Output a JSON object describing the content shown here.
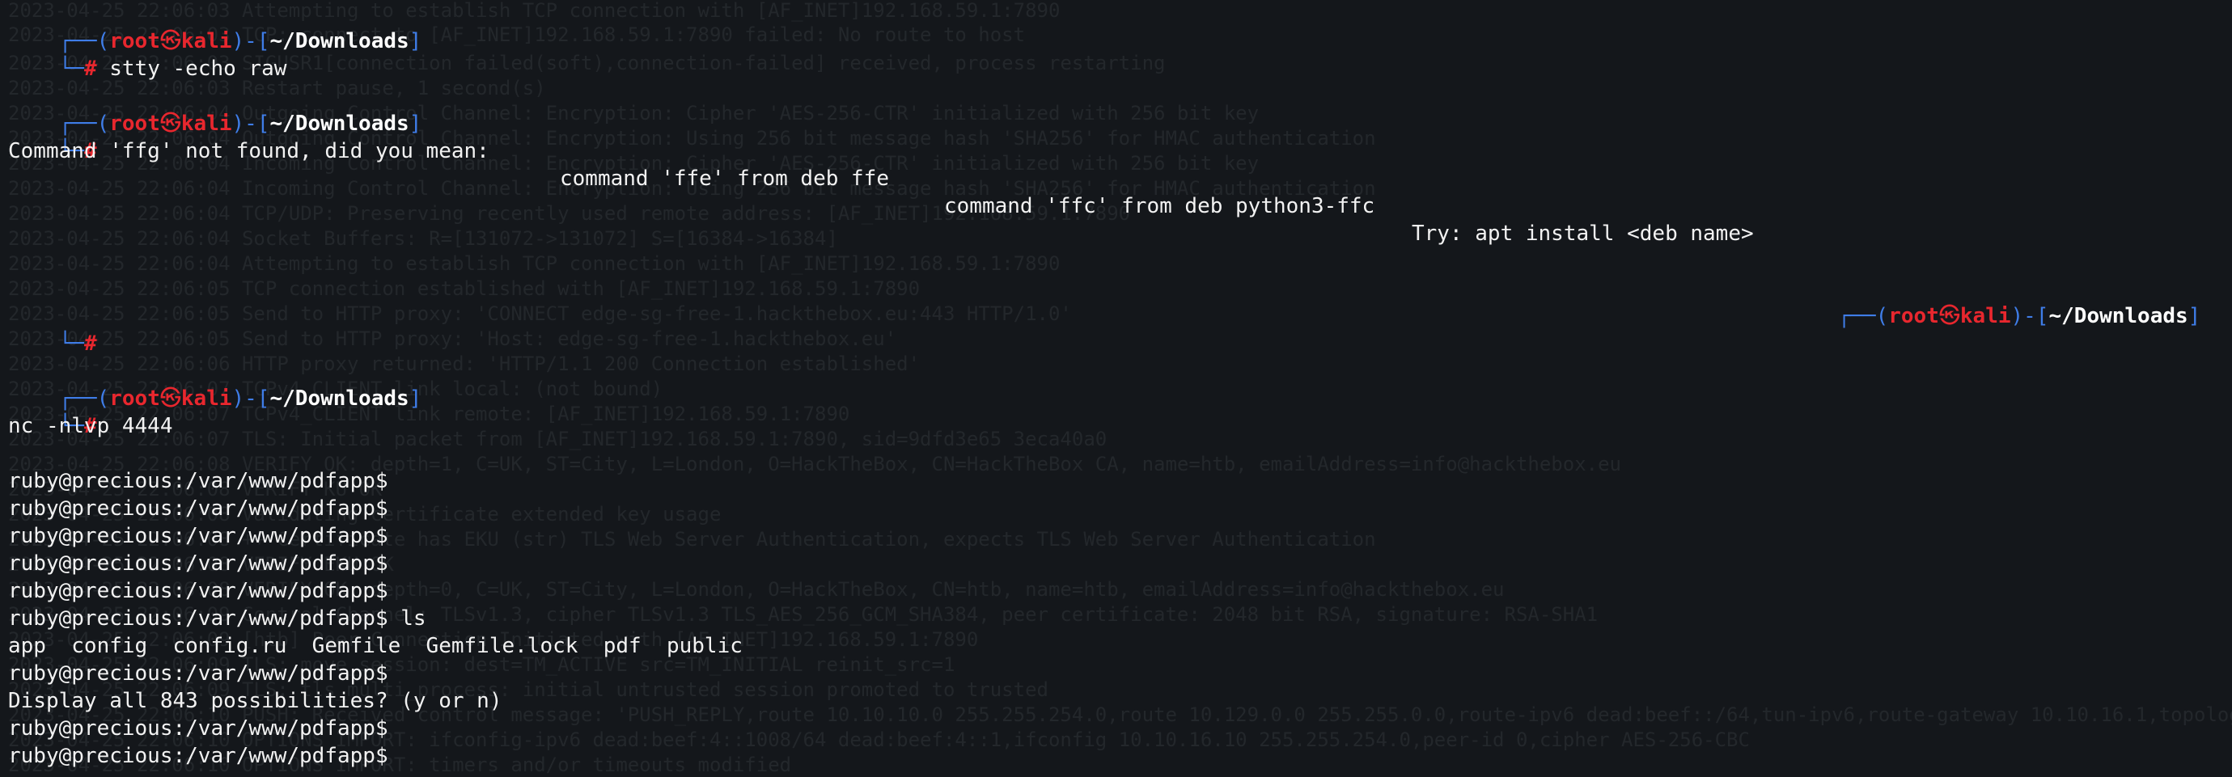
{
  "prompt": {
    "user": "root",
    "skull": "㉿",
    "host": "kali",
    "cwd": "~/Downloads",
    "open_corner": "┌──",
    "paren_open": "(",
    "paren_close": ")",
    "dash": "-",
    "bracket_open": "[",
    "bracket_close": "]",
    "close_corner": "└─",
    "hash": "#"
  },
  "colors": {
    "background": "#14171b",
    "prompt_frame": "#3f7de8",
    "prompt_user": "#e8272e",
    "text": "#f2f2f2"
  },
  "terminal": {
    "commands": {
      "stty": "stty -echo raw",
      "nc": "nc -nlvp 4444"
    },
    "ffg_not_found": "Command 'ffg' not found, did you mean:",
    "suggestion_ffe": "command 'ffe' from deb ffe",
    "suggestion_ffc": "command 'ffc' from deb python3-ffc",
    "try_install": "Try: apt install <deb name>",
    "ruby_prompt": "ruby@precious:/var/www/pdfapp$",
    "ruby_ls_cmd": " ls",
    "ls_output": "app  config  config.ru  Gemfile  Gemfile.lock  pdf  public",
    "display_all": "Display all 843 possibilities? (y or n)"
  },
  "background_log": [
    "2023-04-25 22:06:03 Attempting to establish TCP connection with [AF_INET]192.168.59.1:7890",
    "2023-04-25 22:06:03 TCP: connect to [AF_INET]192.168.59.1:7890 failed: No route to host",
    "2023-04-25 22:06:03 SIGUSR1[connection failed(soft),connection-failed] received, process restarting",
    "2023-04-25 22:06:03 Restart pause, 1 second(s)",
    "2023-04-25 22:06:04 Outgoing Control Channel: Encryption: Cipher 'AES-256-CTR' initialized with 256 bit key",
    "2023-04-25 22:06:04 Outgoing Control Channel: Encryption: Using 256 bit message hash 'SHA256' for HMAC authentication",
    "2023-04-25 22:06:04 Incoming Control Channel: Encryption: Cipher 'AES-256-CTR' initialized with 256 bit key",
    "2023-04-25 22:06:04 Incoming Control Channel: Encryption: Using 256 bit message hash 'SHA256' for HMAC authentication",
    "2023-04-25 22:06:04 TCP/UDP: Preserving recently used remote address: [AF_INET]192.168.59.1:7890",
    "2023-04-25 22:06:04 Socket Buffers: R=[131072->131072] S=[16384->16384]",
    "2023-04-25 22:06:04 Attempting to establish TCP connection with [AF_INET]192.168.59.1:7890",
    "2023-04-25 22:06:05 TCP connection established with [AF_INET]192.168.59.1:7890",
    "2023-04-25 22:06:05 Send to HTTP proxy: 'CONNECT edge-sg-free-1.hackthebox.eu:443 HTTP/1.0'",
    "2023-04-25 22:06:05 Send to HTTP proxy: 'Host: edge-sg-free-1.hackthebox.eu'",
    "2023-04-25 22:06:06 HTTP proxy returned: 'HTTP/1.1 200 Connection established'",
    "2023-04-25 22:06:07 TCPv4_CLIENT link local: (not bound)",
    "2023-04-25 22:06:07 TCPv4_CLIENT link remote: [AF_INET]192.168.59.1:7890",
    "2023-04-25 22:06:07 TLS: Initial packet from [AF_INET]192.168.59.1:7890, sid=9dfd3e65 3eca40a0",
    "2023-04-25 22:06:08 VERIFY OK: depth=1, C=UK, ST=City, L=London, O=HackTheBox, CN=HackTheBox CA, name=htb, emailAddress=info@hackthebox.eu",
    "2023-04-25 22:06:08 VERIFY KU OK",
    "2023-04-25 22:06:08 Validating certificate extended key usage",
    "2023-04-25 22:06:08 ++ Certificate has EKU (str) TLS Web Server Authentication, expects TLS Web Server Authentication",
    "2023-04-25 22:06:08 VERIFY EKU OK",
    "2023-04-25 22:06:08 VERIFY OK: depth=0, C=UK, ST=City, L=London, O=HackTheBox, CN=htb, name=htb, emailAddress=info@hackthebox.eu",
    "2023-04-25 22:06:09 Control Channel: TLSv1.3, cipher TLSv1.3 TLS_AES_256_GCM_SHA384, peer certificate: 2048 bit RSA, signature: RSA-SHA1",
    "2023-04-25 22:06:09 [htb] Peer Connection Initiated with [AF_INET]192.168.59.1:7890",
    "2023-04-25 22:06:09 TLS: move_session: dest=TM_ACTIVE src=TM_INITIAL reinit_src=1",
    "2023-04-25 22:06:09 TLS: tls_multi_process: initial untrusted session promoted to trusted",
    "2023-04-25 22:06:10 PUSH: Received control message: 'PUSH_REPLY,route 10.10.10.0 255.255.254.0,route 10.129.0.0 255.255.0.0,route-ipv6 dead:beef::/64,tun-ipv6,route-gateway 10.10.16.1,topology subnet,ping 10,ping-restart 120'",
    "2023-04-25 22:06:10 OPTIONS IMPORT: ifconfig-ipv6 dead:beef:4::1008/64 dead:beef:4::1,ifconfig 10.10.16.10 255.255.254.0,peer-id 0,cipher AES-256-CBC",
    "2023-04-25 22:06:10 OPTIONS IMPORT: timers and/or timeouts modified"
  ]
}
